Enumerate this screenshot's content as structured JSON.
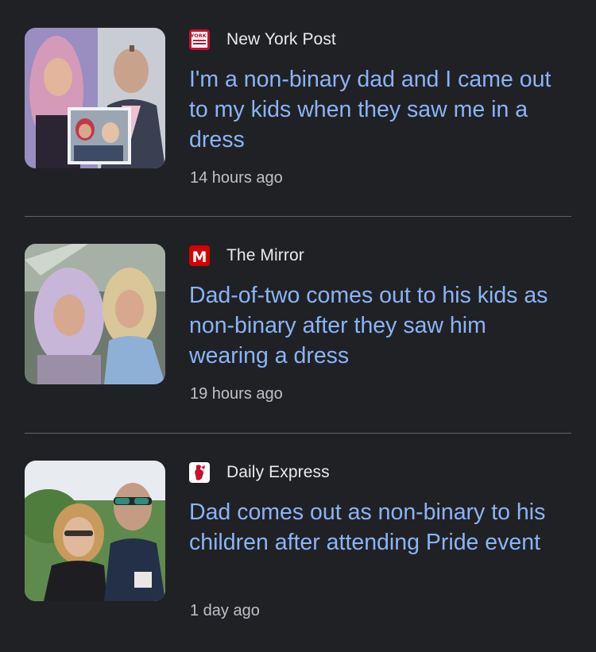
{
  "feed": {
    "articles": [
      {
        "source": "New York Post",
        "logo": "new-york-post-logo",
        "logo_text": "NEW YORK POST",
        "title": "I'm a non-binary dad and I came out to my kids when they saw me in a dress",
        "time": "14 hours ago",
        "thumbnail": "photo-collage-person-in-pink-wig-and-man-in-suit"
      },
      {
        "source": "The Mirror",
        "logo": "the-mirror-logo",
        "logo_text": "M",
        "title": "Dad-of-two comes out to his kids as non-binary after they saw him wearing a dress",
        "time": "19 hours ago",
        "thumbnail": "photo-two-people-in-wigs"
      },
      {
        "source": "Daily Express",
        "logo": "daily-express-logo",
        "title": "Dad comes out as non-binary to his children after attending Pride event",
        "time": "1 day ago",
        "thumbnail": "photo-woman-and-man-in-sunglasses-outdoors"
      }
    ]
  },
  "colors": {
    "background": "#202124",
    "headline": "#8ab4f8",
    "source_text": "#e8eaed",
    "meta_text": "#bdc1c6",
    "divider": "#5f6368",
    "nyp_red": "#c4122f",
    "mirror_red": "#d50000"
  }
}
